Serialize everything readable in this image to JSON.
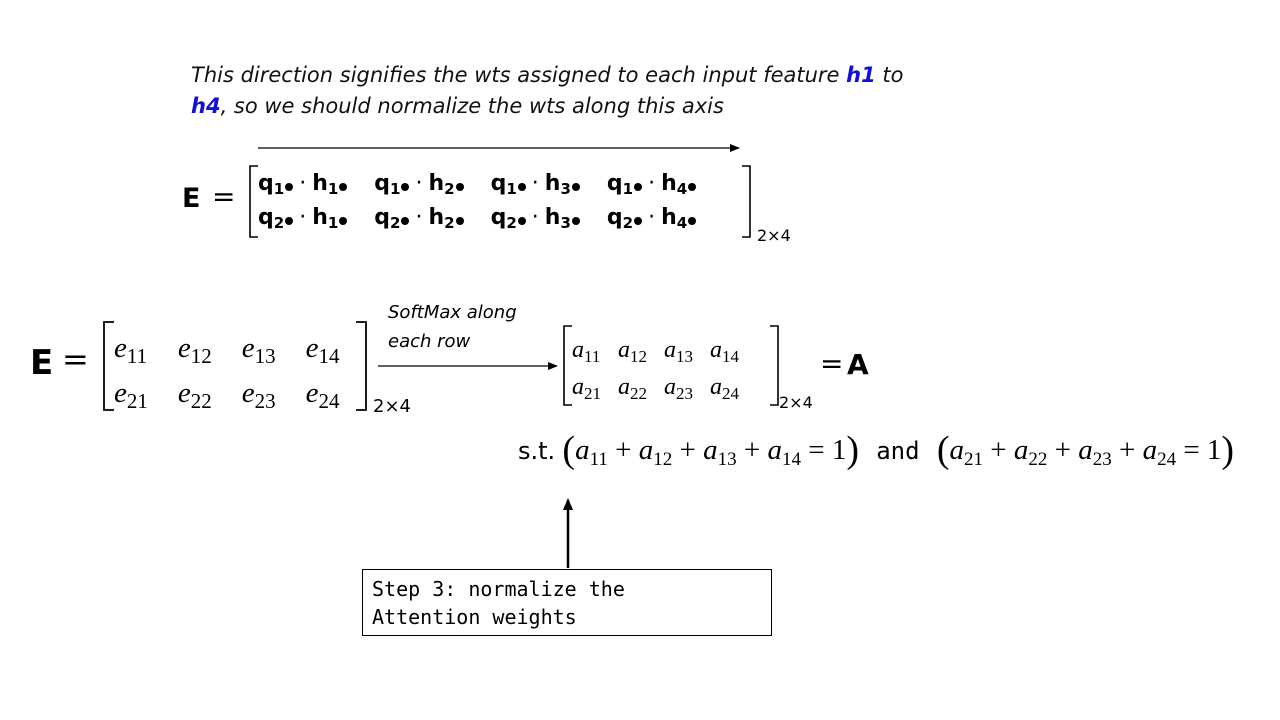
{
  "caption": {
    "part1": "This direction signifies the wts assigned to each input feature ",
    "h1": "h1",
    "part2": " to",
    "h4": "h4",
    "part3": ", so we should normalize the wts along this axis"
  },
  "top_matrix": {
    "lhs": "E",
    "equals": "=",
    "rows": [
      [
        {
          "q": "q",
          "qi": "1",
          "h": "h",
          "hi": "1"
        },
        {
          "q": "q",
          "qi": "1",
          "h": "h",
          "hi": "2"
        },
        {
          "q": "q",
          "qi": "1",
          "h": "h",
          "hi": "3"
        },
        {
          "q": "q",
          "qi": "1",
          "h": "h",
          "hi": "4"
        }
      ],
      [
        {
          "q": "q",
          "qi": "2",
          "h": "h",
          "hi": "1"
        },
        {
          "q": "q",
          "qi": "2",
          "h": "h",
          "hi": "2"
        },
        {
          "q": "q",
          "qi": "2",
          "h": "h",
          "hi": "3"
        },
        {
          "q": "q",
          "qi": "2",
          "h": "h",
          "hi": "4"
        }
      ]
    ],
    "dimension": "2×4"
  },
  "e_matrix": {
    "lhs": "E",
    "equals": "=",
    "rows": [
      [
        {
          "s": "e",
          "i": "11"
        },
        {
          "s": "e",
          "i": "12"
        },
        {
          "s": "e",
          "i": "13"
        },
        {
          "s": "e",
          "i": "14"
        }
      ],
      [
        {
          "s": "e",
          "i": "21"
        },
        {
          "s": "e",
          "i": "22"
        },
        {
          "s": "e",
          "i": "23"
        },
        {
          "s": "e",
          "i": "24"
        }
      ]
    ],
    "dimension": "2×4"
  },
  "softmax": {
    "line1": "SoftMax along",
    "line2": "each row"
  },
  "a_matrix": {
    "rows": [
      [
        {
          "s": "a",
          "i": "11"
        },
        {
          "s": "a",
          "i": "12"
        },
        {
          "s": "a",
          "i": "13"
        },
        {
          "s": "a",
          "i": "14"
        }
      ],
      [
        {
          "s": "a",
          "i": "21"
        },
        {
          "s": "a",
          "i": "22"
        },
        {
          "s": "a",
          "i": "23"
        },
        {
          "s": "a",
          "i": "24"
        }
      ]
    ],
    "dimension": "2×4",
    "equals": "=",
    "rhs": "A"
  },
  "constraint": {
    "st": "s.t.",
    "and": "and",
    "plus": "+",
    "equals": "=",
    "one": "1",
    "open": "(",
    "close": ")",
    "row1": [
      {
        "s": "a",
        "i": "11"
      },
      {
        "s": "a",
        "i": "12"
      },
      {
        "s": "a",
        "i": "13"
      },
      {
        "s": "a",
        "i": "14"
      }
    ],
    "row2": [
      {
        "s": "a",
        "i": "21"
      },
      {
        "s": "a",
        "i": "22"
      },
      {
        "s": "a",
        "i": "23"
      },
      {
        "s": "a",
        "i": "24"
      }
    ]
  },
  "step_box": {
    "line1": "Step 3: normalize the",
    "line2": "Attention weights"
  },
  "colors": {
    "highlight": "#1010d8",
    "ink": "#000000",
    "background": "#ffffff"
  }
}
